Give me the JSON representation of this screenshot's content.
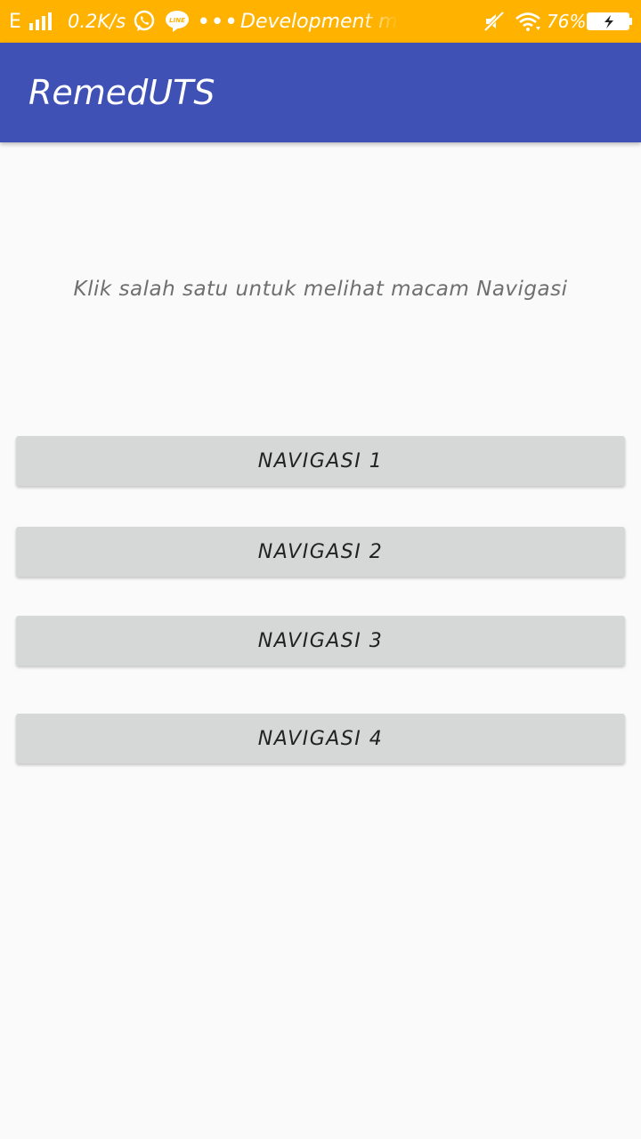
{
  "status_bar": {
    "network_type": "E",
    "network_speed": "0.2K/s",
    "notification_more": "•••",
    "notification_text": "Development m",
    "battery_percent": "76%",
    "icons": [
      "signal-bars-icon",
      "whatsapp-icon",
      "line-app-icon",
      "muted-icon",
      "wifi-icon",
      "battery-charging-icon"
    ]
  },
  "app_bar": {
    "title": "RemedUTS",
    "color": "#3f51b5"
  },
  "main": {
    "instruction": "Klik salah satu untuk melihat macam Navigasi",
    "buttons": [
      {
        "label": "NAVIGASI 1"
      },
      {
        "label": "NAVIGASI 2"
      },
      {
        "label": "NAVIGASI 3"
      },
      {
        "label": "NAVIGASI 4"
      }
    ]
  },
  "colors": {
    "status_bar": "#ffb300",
    "app_bar": "#3f51b5",
    "background": "#fafafa",
    "button": "#d6d7d7"
  }
}
